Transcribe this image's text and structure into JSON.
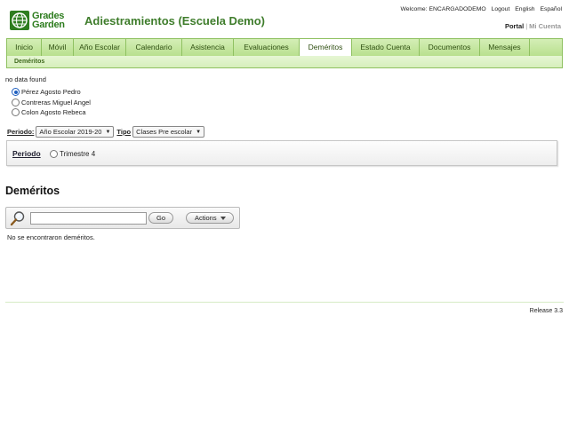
{
  "header": {
    "logo_line1": "Grades",
    "logo_line2": "Garden",
    "title": "Adiestramientos (Escuela Demo)",
    "welcome": "Welcome: ENCARGADODEMO",
    "logout": "Logout",
    "english": "English",
    "espanol": "Español",
    "portal": "Portal",
    "separator": "|",
    "mi_cuenta": "Mi Cuenta"
  },
  "nav": {
    "tabs": [
      {
        "label": "Inicio"
      },
      {
        "label": "Móvil"
      },
      {
        "label": "Año Escolar"
      },
      {
        "label": "Calendario"
      },
      {
        "label": "Asistencia"
      },
      {
        "label": "Evaluaciones"
      },
      {
        "label": "Deméritos"
      },
      {
        "label": "Estado Cuenta"
      },
      {
        "label": "Documentos"
      },
      {
        "label": "Mensajes"
      }
    ],
    "active_index": 6,
    "subnav": "Deméritos"
  },
  "nodata": "no data found",
  "students": [
    {
      "name": "Pérez Agosto Pedro",
      "selected": true
    },
    {
      "name": "Contreras Miguel Angel",
      "selected": false
    },
    {
      "name": "Colon Agosto Rebeca",
      "selected": false
    }
  ],
  "filters": {
    "periodo_label": "Periodo:",
    "periodo_value": "Año Escolar 2019-20",
    "tipo_label": "Tipo",
    "tipo_value": "Clases Pre escolar"
  },
  "periodo_box": {
    "label": "Periodo",
    "option": "Trimestre 4"
  },
  "section_title": "Deméritos",
  "search": {
    "value": "",
    "go": "Go",
    "actions": "Actions"
  },
  "empty_message": "No se encontraron deméritos.",
  "footer": {
    "release": "Release 3.3"
  },
  "colors": {
    "brand_green": "#3f7d2c",
    "nav_bg": "#b9e08f",
    "radio_selected": "#1f5fbf"
  }
}
